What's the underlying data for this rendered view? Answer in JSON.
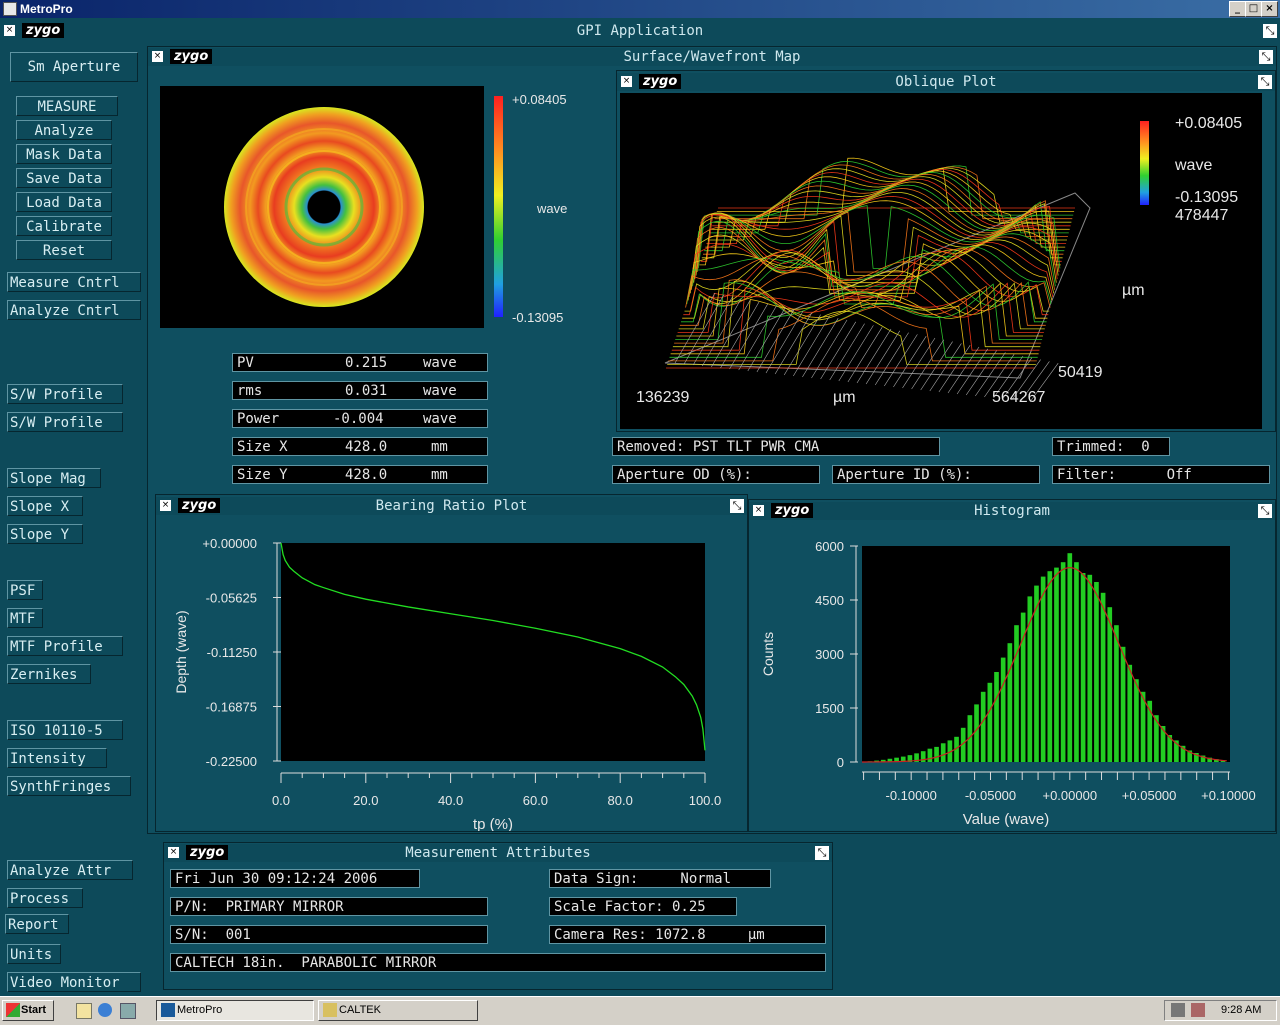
{
  "window": {
    "title": "MetroPro",
    "btn_min": "_",
    "btn_max": "□",
    "btn_close": "×"
  },
  "gpi": {
    "title": "GPI Application",
    "logo": "zygo"
  },
  "sidebar": {
    "aperture": "Sm Aperture",
    "items": [
      "MEASURE",
      "Analyze",
      "Mask Data",
      "Save Data",
      "Load Data",
      "Calibrate",
      "Reset"
    ],
    "ctrl": [
      "Measure Cntrl",
      "Analyze Cntrl"
    ],
    "profiles": [
      "S/W Profile",
      "S/W Profile"
    ],
    "slope": [
      "Slope Mag",
      "Slope X",
      "Slope Y"
    ],
    "optics": [
      "PSF",
      "MTF",
      "MTF Profile",
      "Zernikes"
    ],
    "misc": [
      "ISO 10110-5",
      "Intensity",
      "SynthFringes"
    ],
    "bottom": [
      "Analyze Attr",
      "Process",
      "Report",
      "Units",
      "Video Monitor"
    ]
  },
  "surface": {
    "title": "Surface/Wavefront Map",
    "scale_max": "+0.08405",
    "scale_min": "-0.13095",
    "scale_unit": "wave",
    "stats": [
      {
        "label": "PV",
        "value": "0.215",
        "unit": "wave"
      },
      {
        "label": "rms",
        "value": "0.031",
        "unit": "wave"
      },
      {
        "label": "Power",
        "value": "-0.004",
        "unit": "wave"
      },
      {
        "label": "Size X",
        "value": "428.0",
        "unit": "mm"
      },
      {
        "label": "Size Y",
        "value": "428.0",
        "unit": "mm"
      }
    ]
  },
  "oblique": {
    "title": "Oblique Plot",
    "scale_max": "+0.08405",
    "scale_unit": "wave",
    "scale_min": "-0.13095",
    "z_val": "478447",
    "y_unit": "µm",
    "y_val": "50419",
    "x_min": "136239",
    "x_unit": "µm",
    "x_max": "564267"
  },
  "info": {
    "removed": "Removed: PST TLT PWR CMA",
    "trimmed": "Trimmed:  0",
    "aperture_od": "Aperture OD (%):",
    "aperture_id": "Aperture ID (%):",
    "filter": "Filter:      Off"
  },
  "bearing": {
    "title": "Bearing Ratio Plot"
  },
  "histogram": {
    "title": "Histogram"
  },
  "chart_data": [
    {
      "type": "line",
      "title": "Bearing Ratio Plot",
      "xlabel": "tp (%)",
      "ylabel": "Depth (wave)",
      "xlim": [
        0,
        100
      ],
      "ylim": [
        -0.225,
        0.0
      ],
      "xticks": [
        "0.0",
        "20.0",
        "40.0",
        "60.0",
        "80.0",
        "100.0"
      ],
      "yticks": [
        "+0.00000",
        "-0.05625",
        "-0.11250",
        "-0.16875",
        "-0.22500"
      ],
      "x": [
        0,
        0.5,
        1,
        2,
        3,
        5,
        8,
        10,
        15,
        20,
        30,
        40,
        50,
        60,
        70,
        80,
        85,
        90,
        93,
        95,
        97,
        98,
        99,
        99.5,
        100
      ],
      "y": [
        0.0,
        -0.012,
        -0.018,
        -0.025,
        -0.029,
        -0.036,
        -0.043,
        -0.046,
        -0.053,
        -0.058,
        -0.066,
        -0.073,
        -0.08,
        -0.088,
        -0.097,
        -0.109,
        -0.117,
        -0.128,
        -0.138,
        -0.146,
        -0.158,
        -0.167,
        -0.18,
        -0.192,
        -0.214
      ],
      "line_color": "#22dd22",
      "grid": false
    },
    {
      "type": "bar",
      "title": "Histogram",
      "xlabel": "Value (wave)",
      "ylabel": "Counts",
      "xlim": [
        -0.131,
        0.101
      ],
      "ylim": [
        0,
        6000
      ],
      "xticks": [
        "-0.10000",
        "-0.05000",
        "+0.00000",
        "+0.05000",
        "+0.10000"
      ],
      "yticks": [
        "6000",
        "4500",
        "3000",
        "1500",
        "0"
      ],
      "bin_width": 0.0042,
      "x": [
        -0.126,
        -0.1218,
        -0.1176,
        -0.1134,
        -0.1092,
        -0.105,
        -0.1008,
        -0.0966,
        -0.0924,
        -0.0882,
        -0.084,
        -0.0798,
        -0.0756,
        -0.0714,
        -0.0672,
        -0.063,
        -0.0588,
        -0.0546,
        -0.0504,
        -0.0462,
        -0.042,
        -0.0378,
        -0.0336,
        -0.0294,
        -0.0252,
        -0.021,
        -0.0168,
        -0.0126,
        -0.0084,
        -0.0042,
        0.0,
        0.0042,
        0.0084,
        0.0126,
        0.0168,
        0.021,
        0.0252,
        0.0294,
        0.0336,
        0.0378,
        0.042,
        0.0462,
        0.0504,
        0.0546,
        0.0588,
        0.063,
        0.0672,
        0.0714,
        0.0756,
        0.0798,
        0.084,
        0.0882,
        0.0924,
        0.0966
      ],
      "values": [
        20,
        40,
        60,
        90,
        120,
        150,
        190,
        240,
        300,
        370,
        420,
        520,
        600,
        700,
        950,
        1300,
        1600,
        1950,
        2200,
        2500,
        2900,
        3300,
        3800,
        4150,
        4600,
        4900,
        5150,
        5300,
        5400,
        5550,
        5800,
        5550,
        5250,
        5200,
        5000,
        4700,
        4300,
        3800,
        3200,
        2700,
        2300,
        1950,
        1700,
        1300,
        1000,
        750,
        600,
        450,
        320,
        250,
        180,
        120,
        80,
        50
      ],
      "bar_color": "#22cc22",
      "fit_curve_color": "#cc2222",
      "grid": false
    }
  ],
  "attributes": {
    "title": "Measurement Attributes",
    "date": "Fri Jun 30 09:12:24 2006",
    "pn": "P/N:  PRIMARY MIRROR",
    "sn": "S/N:  001",
    "desc": "CALTECH 18in.  PARABOLIC MIRROR",
    "sign": "Data Sign:     Normal",
    "scale": "Scale Factor: 0.25",
    "camres": "Camera Res: 1072.8     µm"
  },
  "taskbar": {
    "start": "Start",
    "task1": "MetroPro",
    "task2": "CALTEK",
    "clock": "9:28 AM"
  },
  "colors": {
    "panel": "#0d4a5a",
    "accent": "#0a246a"
  }
}
